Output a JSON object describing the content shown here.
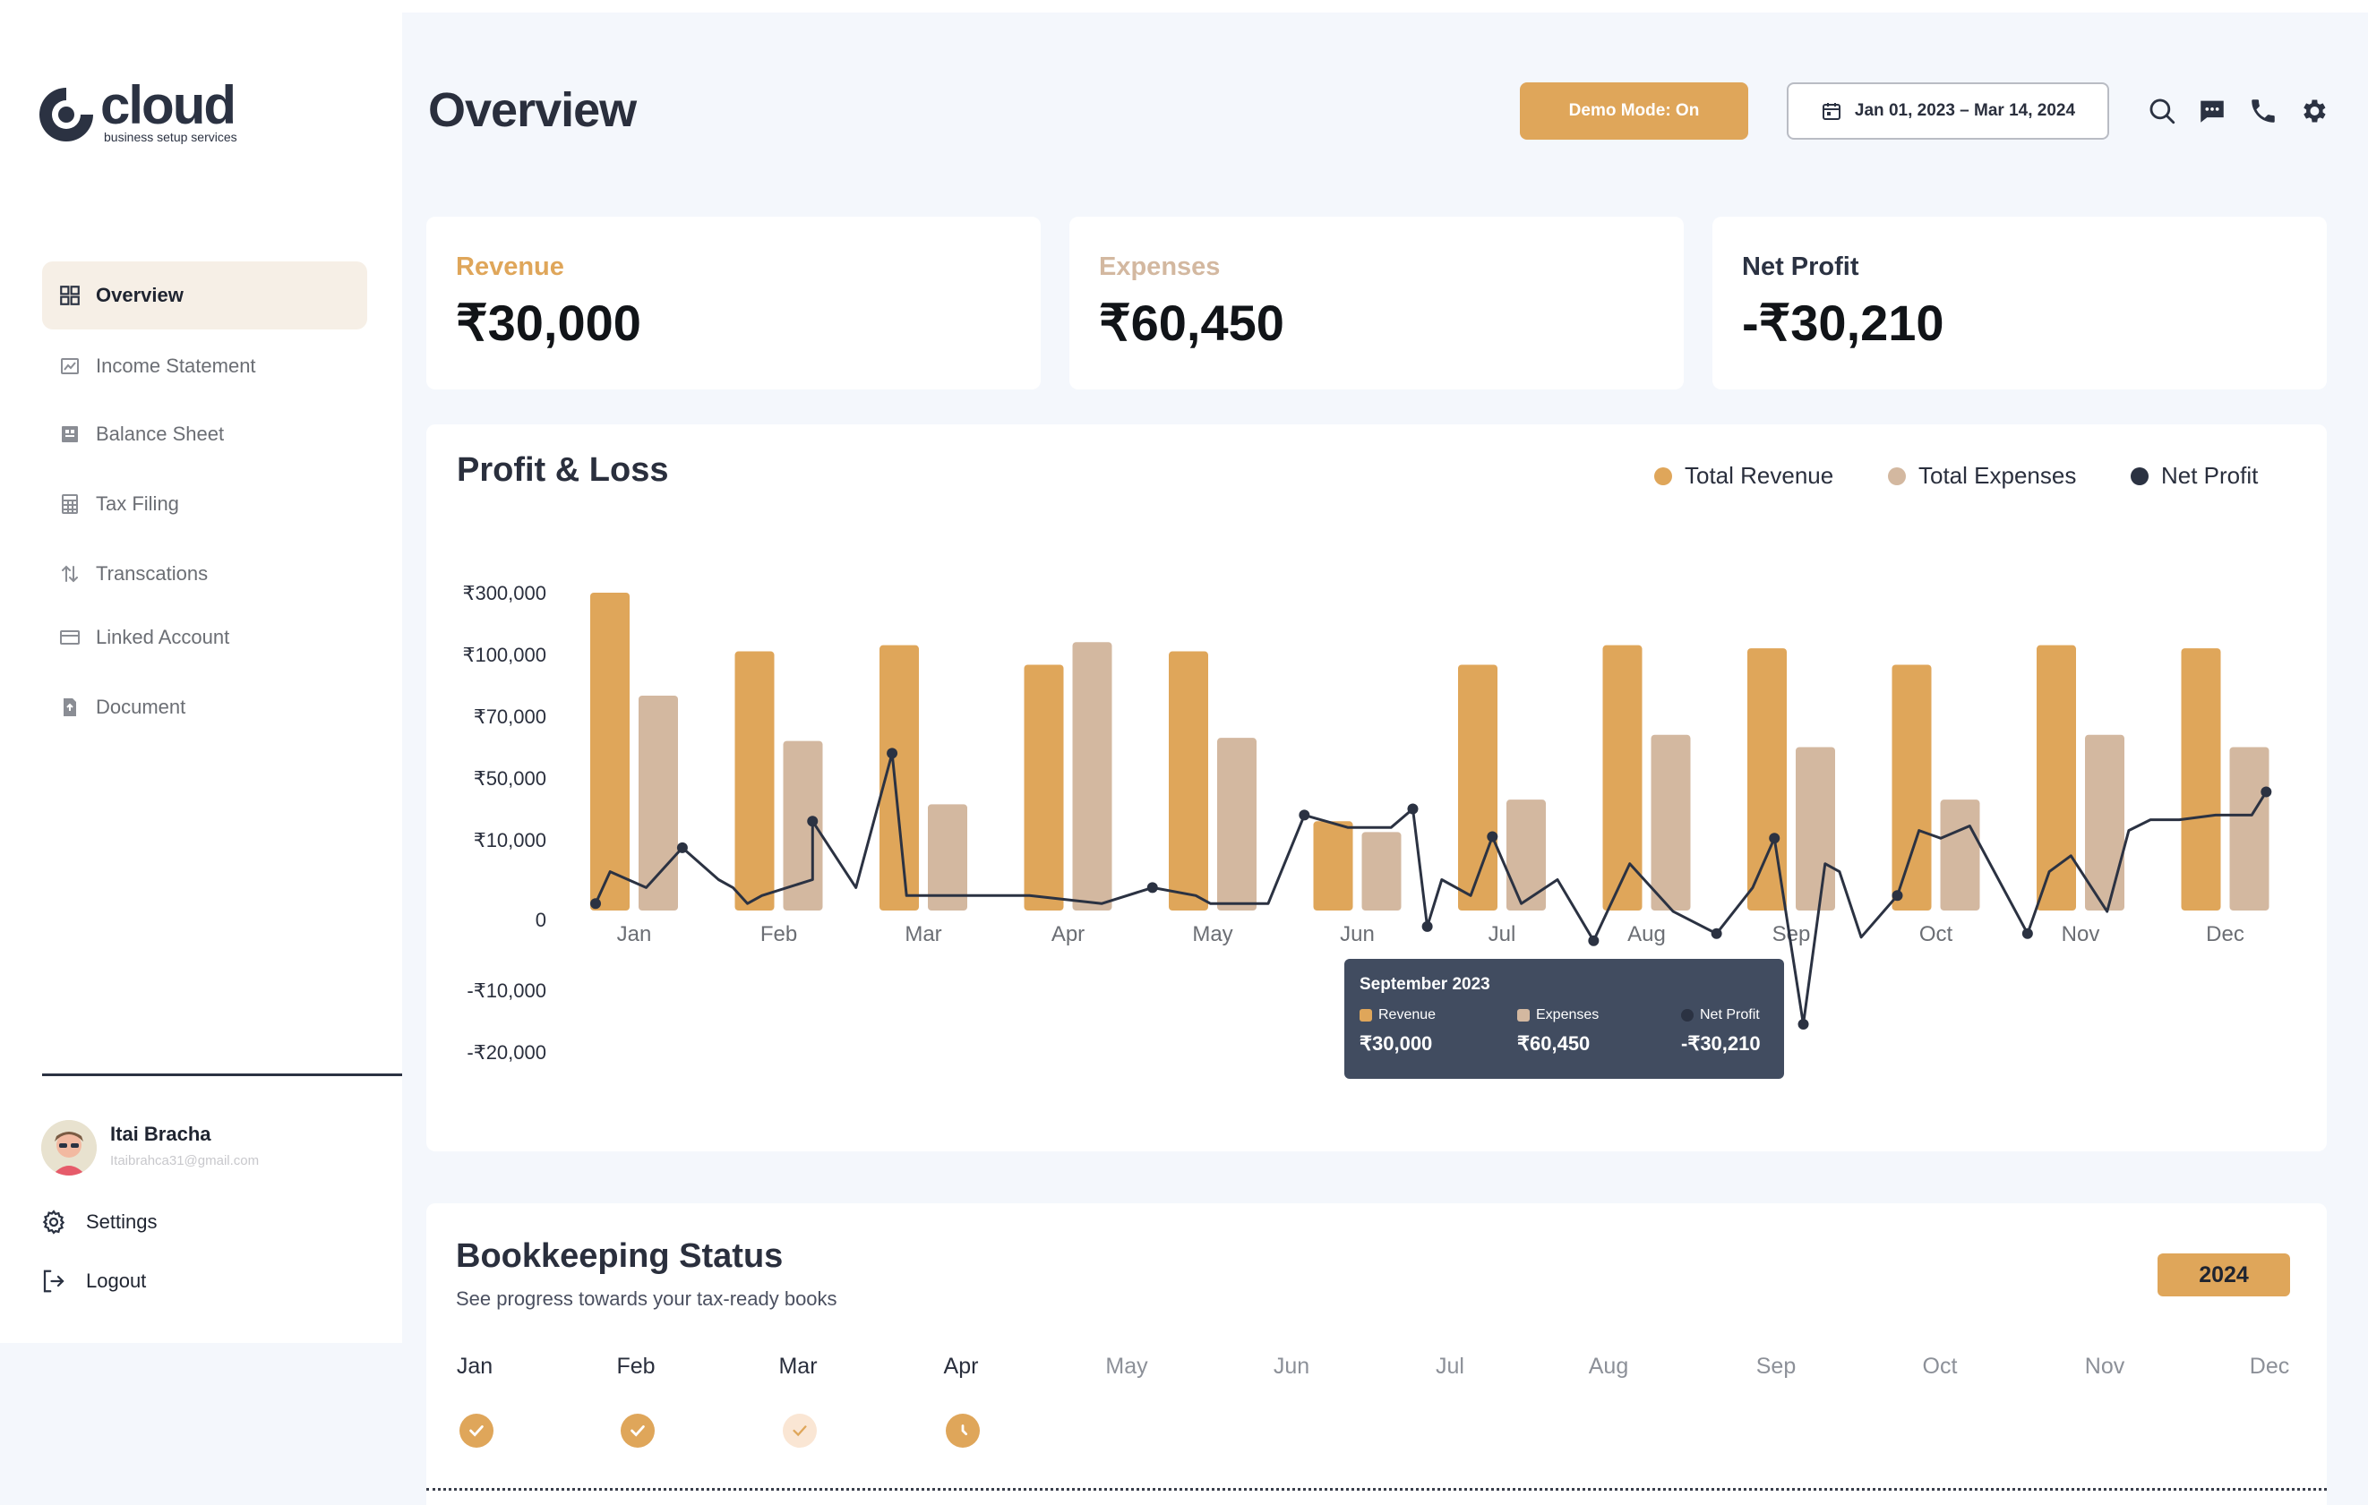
{
  "brand": {
    "name": "cloud",
    "tagline": "business setup services"
  },
  "sidebar": {
    "items": [
      {
        "label": "Overview",
        "icon": "grid-icon",
        "active": true
      },
      {
        "label": "Income Statement",
        "icon": "chart-icon",
        "active": false
      },
      {
        "label": "Balance Sheet",
        "icon": "ledger-icon",
        "active": false
      },
      {
        "label": "Tax Filing",
        "icon": "calculator-icon",
        "active": false
      },
      {
        "label": "Transcations",
        "icon": "transfer-icon",
        "active": false
      },
      {
        "label": "Linked Account",
        "icon": "card-icon",
        "active": false
      },
      {
        "label": "Document",
        "icon": "document-icon",
        "active": false
      }
    ],
    "user": {
      "name": "Itai Bracha",
      "email": "Itaibrahca31@gmail.com"
    },
    "settings_label": "Settings",
    "logout_label": "Logout"
  },
  "header": {
    "title": "Overview",
    "demo_label": "Demo Mode: On",
    "date_range": "Jan 01, 2023 – Mar 14, 2024",
    "icons": [
      "search-icon",
      "chat-icon",
      "phone-icon",
      "gear-icon"
    ]
  },
  "stats": [
    {
      "label": "Revenue",
      "value": "₹30,000",
      "color": "#dfa65a"
    },
    {
      "label": "Expenses",
      "value": "₹60,450",
      "color": "#d3b8a0"
    },
    {
      "label": "Net Profit",
      "value": "-₹30,210",
      "color": "#2b3242"
    }
  ],
  "colors": {
    "revenue": "#dfa65a",
    "expenses": "#d3b8a0",
    "net_profit": "#2b3242",
    "tooltip_bg": "#414c60"
  },
  "chart_data": {
    "type": "bar",
    "title": "Profit & Loss",
    "categories": [
      "Jan",
      "Feb",
      "Mar",
      "Apr",
      "May",
      "Jun",
      "Jul",
      "Aug",
      "Sep",
      "Oct",
      "Nov",
      "Dec"
    ],
    "y_ticks": [
      "₹300,000",
      "₹100,000",
      "₹70,000",
      "₹50,000",
      "₹10,000",
      "0",
      "-₹10,000",
      "-₹20,000"
    ],
    "tick_values": [
      300000,
      100000,
      70000,
      50000,
      10000,
      0,
      -10000,
      -20000
    ],
    "series": [
      {
        "name": "Total Revenue",
        "values": [
          310000,
          110000,
          130000,
          95000,
          110000,
          22000,
          95000,
          130000,
          120000,
          95000,
          130000,
          120000
        ]
      },
      {
        "name": "Total Expenses",
        "values": [
          80000,
          62000,
          33000,
          140000,
          63000,
          15000,
          36000,
          64000,
          60000,
          36000,
          64000,
          60000
        ]
      },
      {
        "name": "Net Profit",
        "points": [
          [
            0.0,
            2000
          ],
          [
            0.1,
            6000
          ],
          [
            0.35,
            4000
          ],
          [
            0.6,
            9000
          ],
          [
            0.85,
            5000
          ],
          [
            0.95,
            4000
          ],
          [
            1.05,
            2000
          ],
          [
            1.15,
            3000
          ],
          [
            1.5,
            5000
          ],
          [
            1.5,
            22000
          ],
          [
            1.8,
            4000
          ],
          [
            2.05,
            58000
          ],
          [
            2.15,
            3000
          ],
          [
            2.5,
            3000
          ],
          [
            3.0,
            3000
          ],
          [
            3.5,
            2000
          ],
          [
            3.85,
            4000
          ],
          [
            4.15,
            3000
          ],
          [
            4.25,
            2000
          ],
          [
            4.55,
            2000
          ],
          [
            4.65,
            2000
          ],
          [
            4.9,
            26000
          ],
          [
            5.2,
            18000
          ],
          [
            5.5,
            18000
          ],
          [
            5.65,
            30000
          ],
          [
            5.75,
            -1000
          ],
          [
            5.85,
            5000
          ],
          [
            6.05,
            3000
          ],
          [
            6.2,
            12000
          ],
          [
            6.4,
            2000
          ],
          [
            6.65,
            5000
          ],
          [
            6.9,
            -3000
          ],
          [
            7.15,
            7000
          ],
          [
            7.45,
            1000
          ],
          [
            7.75,
            -2000
          ],
          [
            8.0,
            4000
          ],
          [
            8.15,
            11000
          ],
          [
            8.35,
            -15500
          ],
          [
            8.5,
            7000
          ],
          [
            8.6,
            6000
          ],
          [
            8.75,
            -2500
          ],
          [
            9.0,
            3000
          ],
          [
            9.15,
            16000
          ],
          [
            9.3,
            11000
          ],
          [
            9.5,
            19000
          ],
          [
            9.9,
            -2000
          ],
          [
            10.05,
            6000
          ],
          [
            10.2,
            8000
          ],
          [
            10.45,
            1000
          ],
          [
            10.6,
            16000
          ],
          [
            10.75,
            23000
          ],
          [
            10.95,
            23000
          ],
          [
            11.2,
            26000
          ],
          [
            11.45,
            26000
          ],
          [
            11.55,
            41000
          ]
        ]
      }
    ],
    "legend_position": "top-right",
    "grid": false
  },
  "tooltip": {
    "title": "September 2023",
    "revenue_label": "Revenue",
    "revenue_value": "₹30,000",
    "expenses_label": "Expenses",
    "expenses_value": "₹60,450",
    "net_label": "Net Profit",
    "net_value": "-₹30,210"
  },
  "bookkeeping": {
    "title": "Bookkeeping Status",
    "subtitle": "See progress towards your tax-ready books",
    "year": "2024",
    "months": [
      {
        "label": "Jan",
        "status": "complete"
      },
      {
        "label": "Feb",
        "status": "complete"
      },
      {
        "label": "Mar",
        "status": "partial"
      },
      {
        "label": "Apr",
        "status": "in-progress"
      },
      {
        "label": "May",
        "status": "none"
      },
      {
        "label": "Jun",
        "status": "none"
      },
      {
        "label": "Jul",
        "status": "none"
      },
      {
        "label": "Aug",
        "status": "none"
      },
      {
        "label": "Sep",
        "status": "none"
      },
      {
        "label": "Oct",
        "status": "none"
      },
      {
        "label": "Nov",
        "status": "none"
      },
      {
        "label": "Dec",
        "status": "none"
      }
    ]
  }
}
